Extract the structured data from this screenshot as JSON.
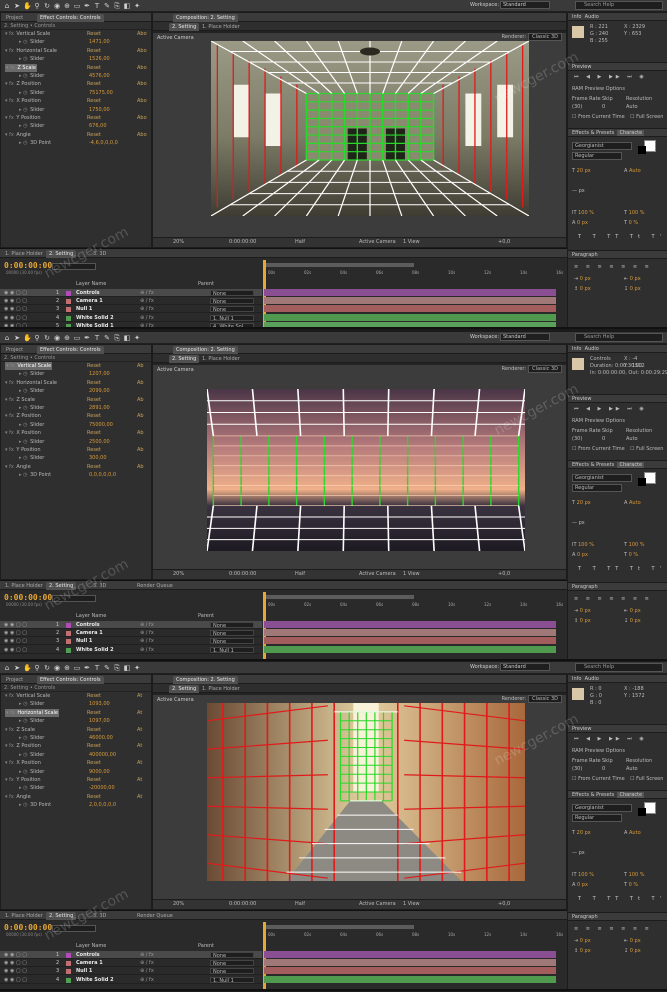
{
  "toolbar": {
    "workspace_label": "Workspace:",
    "workspace_value": "Standard",
    "search_placeholder": "Search Help"
  },
  "shots": [
    {
      "project_tab": "Project",
      "ec_tab": "Effect Controls: Controls",
      "ec_path": "2. Setting • Controls",
      "comp_tab": "Composition: 2. Setting",
      "comp_subtabs": [
        "2. Setting",
        "1. Place Holder"
      ],
      "viewer_label": "Active Camera",
      "renderer_label": "Renderer:",
      "renderer_value": "Classic 3D",
      "zoom": "20%",
      "time": "0:00:00:00",
      "res": "Half",
      "view_camera": "Active Camera",
      "view_count": "1 View",
      "exposure": "+0,0",
      "effect_rows": [
        {
          "label": "Vertical Scale",
          "reset": "Reset",
          "about": "Abo",
          "level": 0,
          "hl": false
        },
        {
          "label": "Slider",
          "value": "1471,00",
          "level": 2,
          "hl": false
        },
        {
          "label": "Horizontal Scale",
          "reset": "Reset",
          "about": "Abo",
          "level": 0,
          "hl": false
        },
        {
          "label": "Slider",
          "value": "1526,00",
          "level": 2,
          "hl": false
        },
        {
          "label": "Z Scale",
          "reset": "Reset",
          "about": "Abo",
          "level": 0,
          "hl": true
        },
        {
          "label": "Slider",
          "value": "4576,00",
          "level": 2,
          "hl": false
        },
        {
          "label": "Z Position",
          "reset": "Reset",
          "about": "Abo",
          "level": 0,
          "hl": false
        },
        {
          "label": "Slider",
          "value": "75175,00",
          "level": 2,
          "hl": false
        },
        {
          "label": "X Position",
          "reset": "Reset",
          "about": "Abo",
          "level": 0,
          "hl": false
        },
        {
          "label": "Slider",
          "value": "1750,00",
          "level": 2,
          "hl": false
        },
        {
          "label": "Y Position",
          "reset": "Reset",
          "about": "Abo",
          "level": 0,
          "hl": false
        },
        {
          "label": "Slider",
          "value": "676,00",
          "level": 2,
          "hl": false
        },
        {
          "label": "Angle",
          "reset": "Reset",
          "about": "Abo",
          "level": 0,
          "hl": false
        },
        {
          "label": "3D Point",
          "value": "-4,6,0,0,0,0",
          "level": 2,
          "hl": false
        }
      ],
      "info": {
        "x": "X : 2329",
        "y": "Y : 653",
        "r": "R : 221",
        "g": "G : 240",
        "b": "B : 255"
      },
      "tl_tabs": [
        "1. Place Holder",
        "2. Setting",
        "3. 3D"
      ],
      "timecode": "0:00:00:00",
      "fps": "00000 (30.00 fps)",
      "ruler": [
        "00s",
        "02s",
        "04s",
        "06s",
        "08s",
        "10s",
        "12s",
        "14s",
        "16s"
      ],
      "layers": [
        {
          "num": "1",
          "name": "Controls",
          "parent": "None",
          "color": "#b24ab8",
          "bar": "#8a4e93"
        },
        {
          "num": "2",
          "name": "Camera 1",
          "parent": "None",
          "color": "#c46f6f",
          "bar": "#a07878"
        },
        {
          "num": "3",
          "name": "Null 1",
          "parent": "None",
          "color": "#c46f6f",
          "bar": "#a45d5d"
        },
        {
          "num": "4",
          "name": "White Solid 2",
          "parent": "1. Null 1",
          "color": "#4fa14f",
          "bar": "#4f9a4f"
        },
        {
          "num": "5",
          "name": "White Solid 1",
          "parent": "4. White Sol",
          "color": "#4fa14f",
          "bar": "#5aa05a"
        }
      ]
    },
    {
      "project_tab": "Project",
      "ec_tab": "Effect Controls: Controls",
      "ec_path": "2. Setting • Controls",
      "comp_tab": "Composition: 2. Setting",
      "comp_subtabs": [
        "2. Setting",
        "1. Place Holder"
      ],
      "viewer_label": "Active Camera",
      "renderer_label": "Renderer:",
      "renderer_value": "Classic 3D",
      "zoom": "20%",
      "time": "0:00:00:00",
      "res": "Half",
      "view_camera": "Active Camera",
      "view_count": "1 View",
      "exposure": "+0,0",
      "effect_rows": [
        {
          "label": "Vertical Scale",
          "reset": "Reset",
          "about": "Ab",
          "level": 0,
          "hl": true
        },
        {
          "label": "Slider",
          "value": "1207,00",
          "level": 2,
          "hl": false
        },
        {
          "label": "Horizontal Scale",
          "reset": "Reset",
          "about": "Ab",
          "level": 0,
          "hl": false
        },
        {
          "label": "Slider",
          "value": "2099,00",
          "level": 2,
          "hl": false
        },
        {
          "label": "Z Scale",
          "reset": "Reset",
          "about": "Ab",
          "level": 0,
          "hl": false
        },
        {
          "label": "Slider",
          "value": "2891,00",
          "level": 2,
          "hl": false
        },
        {
          "label": "Z Position",
          "reset": "Reset",
          "about": "Ab",
          "level": 0,
          "hl": false
        },
        {
          "label": "Slider",
          "value": "75000,00",
          "level": 2,
          "hl": false
        },
        {
          "label": "X Position",
          "reset": "Reset",
          "about": "Ab",
          "level": 0,
          "hl": false
        },
        {
          "label": "Slider",
          "value": "2500,00",
          "level": 2,
          "hl": false
        },
        {
          "label": "Y Position",
          "reset": "Reset",
          "about": "Ab",
          "level": 0,
          "hl": false
        },
        {
          "label": "Slider",
          "value": "300,00",
          "level": 2,
          "hl": false
        },
        {
          "label": "Angle",
          "reset": "Reset",
          "about": "Ab",
          "level": 0,
          "hl": false
        },
        {
          "label": "3D Point",
          "value": "0,0,0,0,0,0",
          "level": 2,
          "hl": false
        }
      ],
      "info": {
        "x": "X : -4",
        "y": "Y : 1512",
        "r": "Controls",
        "g": "Duration: 0:00:30:00",
        "b": "In: 0:00:00:00, Out: 0:00:29:29"
      },
      "tl_tabs": [
        "1. Place Holder",
        "2. Setting",
        "3. 3D",
        "Render Queue"
      ],
      "timecode": "0:00:00:00",
      "fps": "00000 (30.00 fps)",
      "ruler": [
        "00s",
        "02s",
        "04s",
        "06s",
        "08s",
        "10s",
        "12s",
        "14s",
        "16s"
      ],
      "layers": [
        {
          "num": "1",
          "name": "Controls",
          "parent": "None",
          "color": "#b24ab8",
          "bar": "#8a4e93"
        },
        {
          "num": "2",
          "name": "Camera 1",
          "parent": "None",
          "color": "#c46f6f",
          "bar": "#a07878"
        },
        {
          "num": "3",
          "name": "Null 1",
          "parent": "None",
          "color": "#c46f6f",
          "bar": "#a45d5d"
        },
        {
          "num": "4",
          "name": "White Solid 2",
          "parent": "1. Null 1",
          "color": "#4fa14f",
          "bar": "#4f9a4f"
        }
      ]
    },
    {
      "project_tab": "Project",
      "ec_tab": "Effect Controls: Controls",
      "ec_path": "2. Setting • Controls",
      "comp_tab": "Composition: 2. Setting",
      "comp_subtabs": [
        "2. Setting",
        "1. Place Holder"
      ],
      "viewer_label": "Active Camera",
      "renderer_label": "Renderer:",
      "renderer_value": "Classic 3D",
      "zoom": "20%",
      "time": "0:00:00:00",
      "res": "Half",
      "view_camera": "Active Camera",
      "view_count": "1 View",
      "exposure": "+0,0",
      "effect_rows": [
        {
          "label": "Vertical Scale",
          "reset": "Reset",
          "about": "At",
          "level": 0,
          "hl": false
        },
        {
          "label": "Slider",
          "value": "1093,00",
          "level": 2,
          "hl": false
        },
        {
          "label": "Horizontal Scale",
          "reset": "Reset",
          "about": "At",
          "level": 0,
          "hl": true
        },
        {
          "label": "Slider",
          "value": "1097,00",
          "level": 2,
          "hl": false
        },
        {
          "label": "Z Scale",
          "reset": "Reset",
          "about": "At",
          "level": 0,
          "hl": false
        },
        {
          "label": "Slider",
          "value": "46000,00",
          "level": 2,
          "hl": false
        },
        {
          "label": "Z Position",
          "reset": "Reset",
          "about": "At",
          "level": 0,
          "hl": false
        },
        {
          "label": "Slider",
          "value": "400000,00",
          "level": 2,
          "hl": false
        },
        {
          "label": "X Position",
          "reset": "Reset",
          "about": "At",
          "level": 0,
          "hl": false
        },
        {
          "label": "Slider",
          "value": "9000,00",
          "level": 2,
          "hl": false
        },
        {
          "label": "Y Position",
          "reset": "Reset",
          "about": "At",
          "level": 0,
          "hl": false
        },
        {
          "label": "Slider",
          "value": "-20000,00",
          "level": 2,
          "hl": false
        },
        {
          "label": "Angle",
          "reset": "Reset",
          "about": "At",
          "level": 0,
          "hl": false
        },
        {
          "label": "3D Point",
          "value": "2,0,0,0,0,0",
          "level": 2,
          "hl": false
        }
      ],
      "info": {
        "x": "X : -188",
        "y": "Y : 1572",
        "r": "R : 0",
        "g": "G : 0",
        "b": "B : 0"
      },
      "tl_tabs": [
        "1. Place Holder",
        "2. Setting",
        "3. 3D",
        "Render Queue"
      ],
      "timecode": "0:00:00:00",
      "fps": "00000 (30.00 fps)",
      "ruler": [
        "00s",
        "02s",
        "04s",
        "06s",
        "08s",
        "10s",
        "12s",
        "14s",
        "16s"
      ],
      "layers": [
        {
          "num": "1",
          "name": "Controls",
          "parent": "None",
          "color": "#b24ab8",
          "bar": "#8a4e93"
        },
        {
          "num": "2",
          "name": "Camera 1",
          "parent": "None",
          "color": "#c46f6f",
          "bar": "#a07878"
        },
        {
          "num": "3",
          "name": "Null 1",
          "parent": "None",
          "color": "#c46f6f",
          "bar": "#a45d5d"
        },
        {
          "num": "4",
          "name": "White Solid 2",
          "parent": "1. Null 1",
          "color": "#4fa14f",
          "bar": "#4f9a4f"
        }
      ]
    }
  ],
  "right_panels": {
    "info_tab": "Info",
    "audio_tab": "Audio",
    "preview_tab": "Preview",
    "ram_preview": "RAM Preview Options",
    "frame_rate_label": "Frame Rate",
    "skip_label": "Skip",
    "resolution_label": "Resolution",
    "frame_rate_value": "(30)",
    "skip_value": "0",
    "resolution_value": "Auto",
    "from_current": "From Current Time",
    "full_screen": "Full Screen",
    "effects_tab": "Effects & Presets",
    "character_tab": "Characte",
    "font_name": "Georgianist",
    "font_style": "Regular",
    "font_size": "20 px",
    "leading": "Auto",
    "tracking_unit": "px",
    "scale_v": "100 %",
    "scale_h": "100 %",
    "baseline": "0 px",
    "tsume": "0 %",
    "paragraph_tab": "Paragraph",
    "para_values": [
      "0 px",
      "0 px",
      "0 px",
      "0 px",
      "0 px"
    ]
  },
  "watermark": "newcger.com",
  "colors": {
    "accent": "#e6a733",
    "grid_green": "#29d829",
    "grid_red": "#e01a1a",
    "timeline_purple": "#b24ab8"
  }
}
